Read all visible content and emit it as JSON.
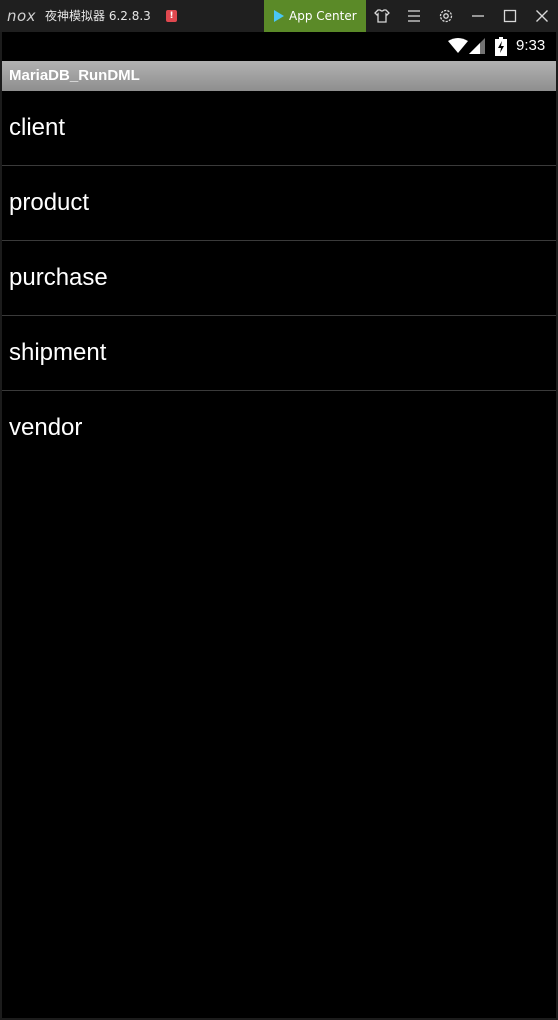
{
  "emulator": {
    "logo": "nox",
    "title": "夜神模拟器 6.2.8.3",
    "alert_badge": "!",
    "app_center_label": "App Center",
    "controls": [
      "shirt-icon",
      "menu-icon",
      "gear-icon",
      "minimize-icon",
      "maximize-icon",
      "close-icon"
    ]
  },
  "status_bar": {
    "time": "9:33",
    "icons": [
      "wifi-icon",
      "signal-icon",
      "battery-charging-icon"
    ]
  },
  "app": {
    "title": "MariaDB_RunDML"
  },
  "list": {
    "items": [
      {
        "label": "client"
      },
      {
        "label": "product"
      },
      {
        "label": "purchase"
      },
      {
        "label": "shipment"
      },
      {
        "label": "vendor"
      }
    ]
  },
  "colors": {
    "app_center_bg": "#5b8a28",
    "emulator_bar_bg": "#1f1f1f",
    "action_bar_bg": "#9e9e9e",
    "list_bg": "#000000",
    "divider": "#3a3a3a"
  }
}
